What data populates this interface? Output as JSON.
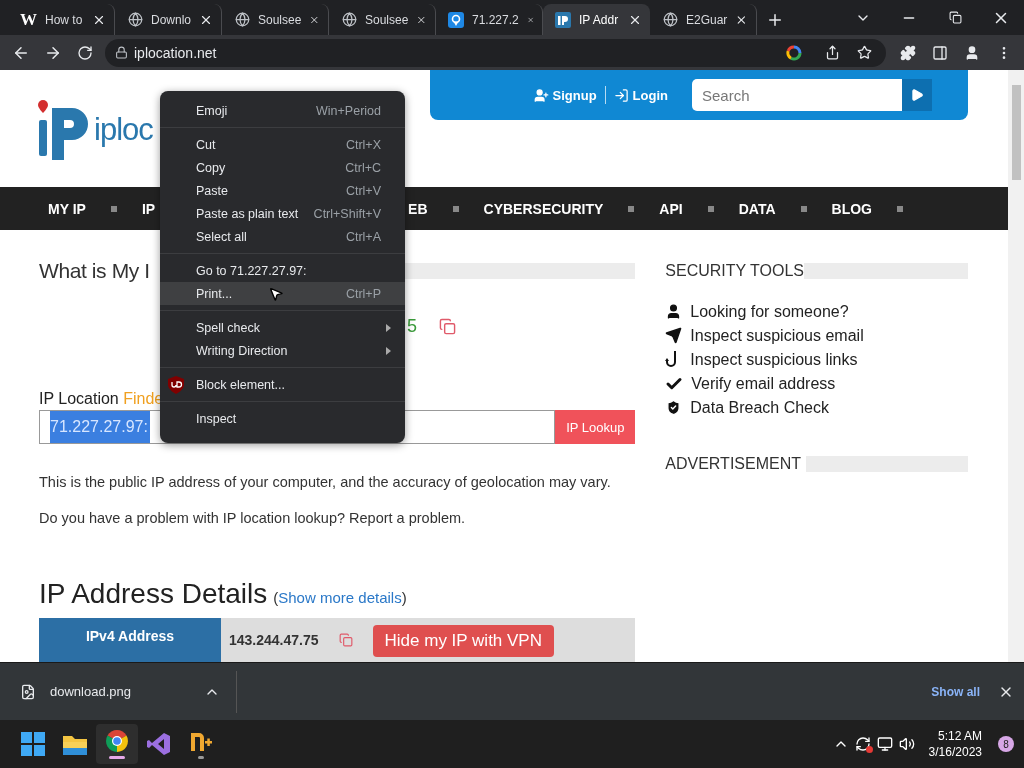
{
  "tabs": [
    {
      "title": "How to",
      "favicon": {
        "kind": "letter",
        "text": "W"
      },
      "selected": false
    },
    {
      "title": "Downlo",
      "favicon": {
        "kind": "globe"
      },
      "selected": false
    },
    {
      "title": "Soulsee",
      "favicon": {
        "kind": "globe"
      },
      "selected": false
    },
    {
      "title": "Soulsee",
      "favicon": {
        "kind": "globe"
      },
      "selected": false
    },
    {
      "title": "71.227.2",
      "favicon": {
        "kind": "pin"
      },
      "selected": false
    },
    {
      "title": "IP Addr",
      "favicon": {
        "kind": "ip"
      },
      "selected": true
    },
    {
      "title": "E2Guar",
      "favicon": {
        "kind": "globe"
      },
      "selected": false
    }
  ],
  "address": {
    "url": "iplocation.net"
  },
  "page": {
    "logo_text": "iploc",
    "header": {
      "signup": "Signup",
      "login": "Login",
      "search_placeholder": "Search"
    },
    "nav": [
      "MY IP",
      "IP",
      "EB",
      "CYBERSECURITY",
      "API",
      "DATA",
      "BLOG"
    ],
    "heading": "What is My I",
    "ip_fragment": "5",
    "finder_label": "IP Location",
    "finder_label_accent": "Finde",
    "ip_value": "71.227.27.97:",
    "lookup_button": "IP Lookup",
    "notes": [
      "This is the public IP address of your computer, and the accuracy of geolocation may vary.",
      "Do you have a problem with IP location lookup? Report a problem."
    ],
    "details_heading": "IP Address Details",
    "details_link": "Show more details",
    "details_brackets": [
      "(",
      ")"
    ],
    "details_row": {
      "label": "IPv4 Address",
      "value": "143.244.47.75",
      "vpn_button": "Hide my IP with VPN"
    },
    "security_title": "SECURITY TOOLS",
    "security_tools": [
      {
        "label": "Looking for someone?",
        "kind": "person"
      },
      {
        "label": "Inspect suspicious email",
        "kind": "plane"
      },
      {
        "label": "Inspect suspicious links",
        "kind": "hook"
      },
      {
        "label": "Verify email address",
        "kind": "check"
      },
      {
        "label": "Data Breach Check",
        "kind": "shield"
      }
    ],
    "ad_title": "ADVERTISEMENT"
  },
  "context_menu": {
    "groups": [
      [
        {
          "label": "Emoji",
          "shortcut": "Win+Period",
          "kind": "plain",
          "submenu": false,
          "highlighted": false
        }
      ],
      [
        {
          "label": "Cut",
          "shortcut": "Ctrl+X",
          "kind": "plain",
          "submenu": false,
          "highlighted": false
        },
        {
          "label": "Copy",
          "shortcut": "Ctrl+C",
          "kind": "plain",
          "submenu": false,
          "highlighted": false
        },
        {
          "label": "Paste",
          "shortcut": "Ctrl+V",
          "kind": "plain",
          "submenu": false,
          "highlighted": false
        },
        {
          "label": "Paste as plain text",
          "shortcut": "Ctrl+Shift+V",
          "kind": "plain",
          "submenu": false,
          "highlighted": false
        },
        {
          "label": "Select all",
          "shortcut": "Ctrl+A",
          "kind": "plain",
          "submenu": false,
          "highlighted": false
        }
      ],
      [
        {
          "label": "Go to 71.227.27.97:",
          "kind": "plain",
          "submenu": false,
          "highlighted": false
        },
        {
          "label": "Print...",
          "shortcut": "Ctrl+P",
          "kind": "plain",
          "submenu": false,
          "highlighted": true
        }
      ],
      [
        {
          "label": "Spell check",
          "kind": "plain",
          "submenu": true,
          "highlighted": false
        },
        {
          "label": "Writing Direction",
          "kind": "plain",
          "submenu": true,
          "highlighted": false
        }
      ],
      [
        {
          "label": "Block element...",
          "kind": "extension",
          "submenu": false,
          "highlighted": false
        }
      ],
      [
        {
          "label": "Inspect",
          "kind": "plain",
          "submenu": false,
          "highlighted": false
        }
      ]
    ]
  },
  "download": {
    "file": "download.png",
    "show_all": "Show all"
  },
  "taskbar": {
    "apps": [
      {
        "kind": "start",
        "selected": false,
        "running": false
      },
      {
        "kind": "folder",
        "selected": false,
        "running": false
      },
      {
        "kind": "browser",
        "selected": true,
        "running": true
      },
      {
        "kind": "ribbon",
        "selected": false,
        "running": false
      },
      {
        "kind": "app",
        "selected": false,
        "running": true
      }
    ],
    "time": "5:12 AM",
    "date": "3/16/2023",
    "badge": "8"
  }
}
